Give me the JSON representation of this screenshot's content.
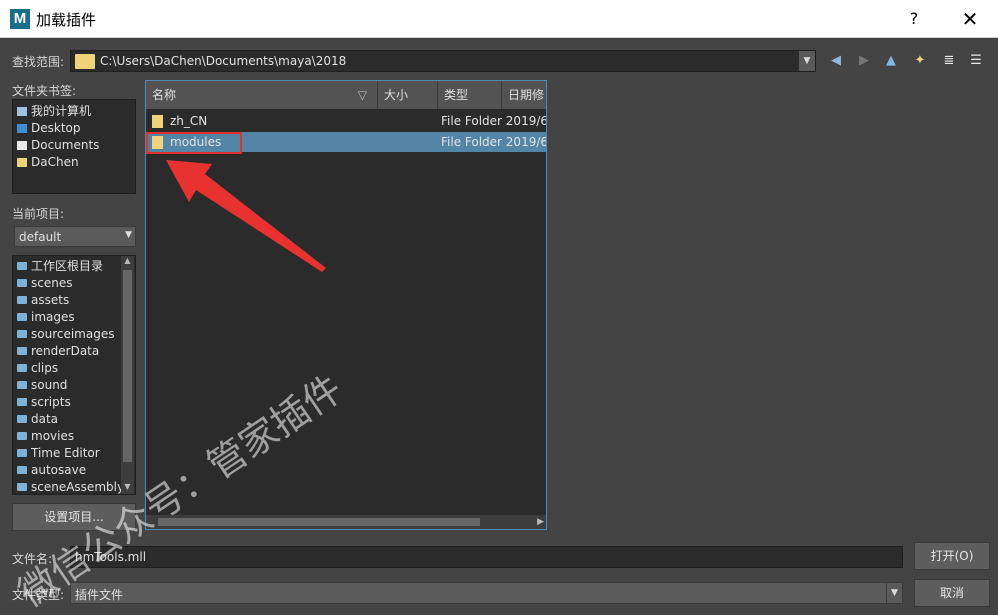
{
  "window": {
    "title": "加载插件",
    "help": "?",
    "close": "✕",
    "logo": "M"
  },
  "lookin": {
    "label": "查找范围:",
    "path": "C:\\Users\\DaChen\\Documents\\maya\\2018"
  },
  "toolbar": {
    "back": "◀",
    "forward": "▶",
    "up": "▲",
    "new_folder": "✦",
    "list_view": "≣",
    "detail_view": "☰"
  },
  "bookmarks": {
    "label": "文件夹书签:",
    "items": [
      {
        "label": "我的计算机",
        "icon": "computer-icon"
      },
      {
        "label": "Desktop",
        "icon": "desktop-icon"
      },
      {
        "label": "Documents",
        "icon": "document-icon"
      },
      {
        "label": "DaChen",
        "icon": "user-folder-icon"
      }
    ]
  },
  "project": {
    "label": "当前项目:",
    "value": "default",
    "folders": [
      "工作区根目录",
      "scenes",
      "assets",
      "images",
      "sourceimages",
      "renderData",
      "clips",
      "sound",
      "scripts",
      "data",
      "movies",
      "Time Editor",
      "autosave",
      "sceneAssembly"
    ],
    "set_button": "设置项目..."
  },
  "fileview": {
    "columns": [
      "名称",
      "大小",
      "类型",
      "日期修"
    ],
    "rows": [
      {
        "name": "zh_CN",
        "type": "File Folder 2019/6/",
        "selected": false
      },
      {
        "name": "modules",
        "type": "File Folder 2019/6/",
        "selected": true
      }
    ]
  },
  "filename": {
    "label": "文件名:",
    "value": "hmTools.mll"
  },
  "filetype": {
    "label": "文件类型:",
    "value": "插件文件"
  },
  "buttons": {
    "open": "打开(O)",
    "cancel": "取消"
  },
  "watermark": {
    "text": "微信公众号：管家插件"
  },
  "colors": {
    "accent": "#5285a6",
    "annotation": "#e03030",
    "background": "#444444"
  }
}
